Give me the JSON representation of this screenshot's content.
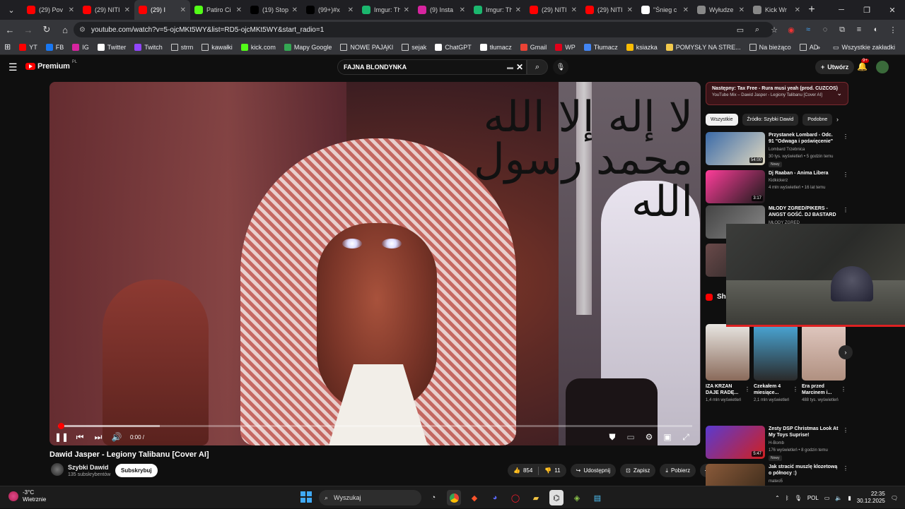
{
  "browser": {
    "tabs": [
      {
        "label": "(29) Pov",
        "icon": "youtube-icon",
        "color": "#ff0000",
        "active": false
      },
      {
        "label": "(29) NITI",
        "icon": "youtube-icon",
        "color": "#ff0000",
        "active": false
      },
      {
        "label": "(29) I",
        "icon": "youtube-icon",
        "color": "#ff0000",
        "active": true
      },
      {
        "label": "Patiro Ci",
        "icon": "kick-icon",
        "color": "#53fc18",
        "active": false
      },
      {
        "label": "(19) Stop",
        "icon": "x-icon",
        "color": "#000000",
        "active": false
      },
      {
        "label": "(99+)#x",
        "icon": "tiktok-icon",
        "color": "#000000",
        "active": false
      },
      {
        "label": "Imgur: Th",
        "icon": "imgur-icon",
        "color": "#1bb76e",
        "active": false
      },
      {
        "label": "(9) Insta",
        "icon": "instagram-icon",
        "color": "#d6249f",
        "active": false
      },
      {
        "label": "Imgur: Th",
        "icon": "imgur-icon",
        "color": "#1bb76e",
        "active": false
      },
      {
        "label": "(29) NITI",
        "icon": "youtube-icon",
        "color": "#ff0000",
        "active": false
      },
      {
        "label": "(29) NITI",
        "icon": "youtube-icon",
        "color": "#ff0000",
        "active": false
      },
      {
        "label": "\"Śnieg c",
        "icon": "tvn-icon",
        "color": "#ffffff",
        "active": false
      },
      {
        "label": "Wyłudze",
        "icon": "globe-icon",
        "color": "#888888",
        "active": false
      },
      {
        "label": "Kick Wr",
        "icon": "globe-icon",
        "color": "#888888",
        "active": false
      }
    ],
    "url": "youtube.com/watch?v=5-ojcMKt5WY&list=RD5-ojcMKt5WY&start_radio=1",
    "bookmarks": [
      {
        "label": "YT",
        "color": "#ff0000"
      },
      {
        "label": "FB",
        "color": "#1877f2"
      },
      {
        "label": "IG",
        "color": "#d6249f"
      },
      {
        "label": "Twitter",
        "color": "#ffffff"
      },
      {
        "label": "Twitch",
        "color": "#9146ff"
      },
      {
        "label": "strm",
        "color": "folder"
      },
      {
        "label": "kawałki",
        "color": "folder"
      },
      {
        "label": "kick.com",
        "color": "#53fc18"
      },
      {
        "label": "Mapy Google",
        "color": "#34a853"
      },
      {
        "label": "NOWE PAJĄKI",
        "color": "folder"
      },
      {
        "label": "sejak",
        "color": "folder"
      },
      {
        "label": "ChatGPT",
        "color": "#ffffff"
      },
      {
        "label": "tłumacz",
        "color": "#ffffff"
      },
      {
        "label": "Gmail",
        "color": "#ea4335"
      },
      {
        "label": "WP",
        "color": "#e2001a"
      },
      {
        "label": "Tłumacz",
        "color": "#4285f4"
      },
      {
        "label": "ksiazka",
        "color": "#fbbc04"
      },
      {
        "label": "POMYSŁY NA STRE...",
        "color": "#f2c94c"
      },
      {
        "label": "Na bieżąco",
        "color": "folder"
      },
      {
        "label": "AD",
        "color": "folder"
      }
    ],
    "all_bookmarks": "Wszystkie zakładki"
  },
  "youtube": {
    "logo_text": "Premium",
    "logo_country": "PL",
    "search_value": "FAJNA BLONDYNKA",
    "create_label": "Utwórz",
    "notif_count": "9+"
  },
  "player": {
    "time": "0:00 /",
    "progress": 0.0,
    "loaded": 0.16
  },
  "video": {
    "title": "Dawid Jasper - Legiony Talibanu [Cover AI]",
    "channel": "Szybki Dawid",
    "subscribers": "135 subskrybentów",
    "subscribe_label": "Subskrybuj",
    "likes": "854",
    "dislikes": "11",
    "share_label": "Udostępnij",
    "save_label": "Zapisz",
    "download_label": "Pobierz"
  },
  "sidebar": {
    "next_title": "Następny: Tax Free - Rura musi yeah (prod. CUZCOS)",
    "next_sub": "YouTube Mix – Dawid Jasper - Legiony Talibanu [Cover AI]",
    "chips": [
      "Wszystkie",
      "Źródło: Szybki Dawid",
      "Podobne"
    ],
    "recs": [
      {
        "title": "Przystanek Lombard - Odc. 91 \"Odwaga i poświęcenie\"",
        "channel": "Lombard Trzebnica",
        "meta": "30 tys. wyświetleń • 5 godzin temu",
        "badge": "Nowy",
        "dur": "54:00",
        "c1": "#3a6aa8",
        "c2": "#e0d8c0"
      },
      {
        "title": "Dj Raaban - Anima Libera",
        "channel": "Kidkickerz",
        "meta": "4 mln wyświetleń • 16 lat temu",
        "badge": "",
        "dur": "3:17",
        "c1": "#ff3d9a",
        "c2": "#1a1a1a"
      },
      {
        "title": "MŁODY ZGRED/PIKERS - ANGST GOŚĆ. DJ BASTARD",
        "channel": "MŁODY ZGRED",
        "meta": "",
        "badge": "",
        "dur": "",
        "c1": "#444444",
        "c2": "#888888"
      },
      {
        "title": "",
        "channel": "",
        "meta": "",
        "badge": "",
        "dur": "",
        "c1": "#6a4a4a",
        "c2": "#222222"
      }
    ],
    "shorts_label": "Shorts",
    "shorts": [
      {
        "title": "IZA KRZAN DAJE RADĘ...",
        "views": "1,4 mln wyświetleń",
        "c1": "#e8e6e2",
        "c2": "#8a6a5a"
      },
      {
        "title": "Czekałem 4 miesiące...",
        "views": "2,1 mln wyświetleń",
        "c1": "#4aa8d8",
        "c2": "#2a2a2a"
      },
      {
        "title": "Era przed Marcinem i...",
        "views": "488 tys. wyświetleń",
        "c1": "#e0c8c0",
        "c2": "#b09080"
      }
    ],
    "recs_bottom": [
      {
        "title": "Zesty DSP Christmas Look At My Toys Suprise!",
        "channel": "H-Bomb",
        "meta": "176 wyświetleń • 8 godzin temu",
        "badge": "Nowy",
        "dur": "5:47",
        "c1": "#5a3ad0",
        "c2": "#d02020"
      },
      {
        "title": "Jak stracić muszlę klozetową o północy :)",
        "channel": "mateo5",
        "meta": "",
        "badge": "",
        "dur": "",
        "c1": "#8a5a3a",
        "c2": "#3a2a1a"
      }
    ]
  },
  "taskbar": {
    "temp": "-3°C",
    "weather": "Wietrznie",
    "search_placeholder": "Wyszukaj",
    "lang": "POL",
    "time": "22:35",
    "date": "30.12.2025"
  }
}
